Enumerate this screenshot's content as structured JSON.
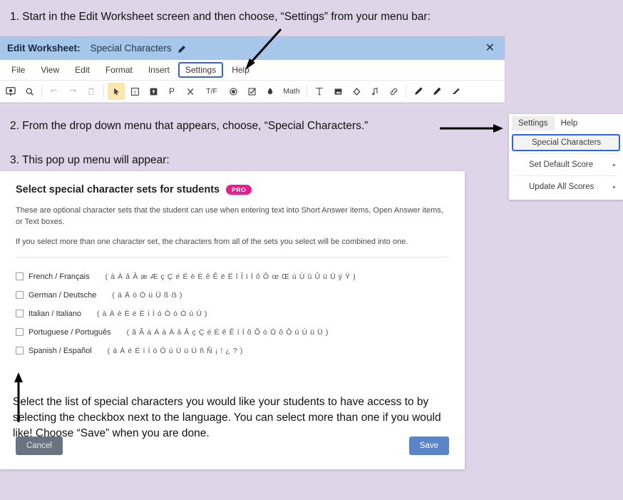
{
  "instructions": {
    "step1": "1. Start in the Edit Worksheet screen and then choose, “Settings” from your menu bar:",
    "step2": "2. From the drop down menu that appears, choose, “Special Characters.”",
    "step3": "3. This pop up menu will appear:",
    "bottom": "Select the list of special characters you would like your students to have access to by selecting the checkbox next to the language. You can select more than one if you would like! Choose “Save” when you are done."
  },
  "editor": {
    "title_label": "Edit Worksheet:",
    "document_name": "Special Characters",
    "edit_pencil_icon": "pencil-icon",
    "close_icon": "✕",
    "menu": [
      {
        "label": "File",
        "highlighted": false
      },
      {
        "label": "View",
        "highlighted": false
      },
      {
        "label": "Edit",
        "highlighted": false
      },
      {
        "label": "Format",
        "highlighted": false
      },
      {
        "label": "Insert",
        "highlighted": false
      },
      {
        "label": "Settings",
        "highlighted": true
      },
      {
        "label": "Help",
        "highlighted": false
      }
    ],
    "toolbar": [
      {
        "icon": "screen-present-icon",
        "glyph": "⬚",
        "state": "normal"
      },
      {
        "icon": "zoom-search-icon",
        "glyph": "⚲",
        "state": "normal"
      },
      {
        "sep": true
      },
      {
        "icon": "undo-icon",
        "glyph": "↶",
        "state": "disabled"
      },
      {
        "icon": "redo-icon",
        "glyph": "↷",
        "state": "disabled"
      },
      {
        "icon": "trash-icon",
        "glyph": "Ὕ1",
        "state": "disabled"
      },
      {
        "sep": true
      },
      {
        "icon": "cursor-select-icon",
        "glyph": "↖",
        "state": "active"
      },
      {
        "icon": "text-box-icon",
        "glyph": "Ⓣ",
        "state": "normal"
      },
      {
        "icon": "image-box-icon",
        "glyph": "▣",
        "state": "normal"
      },
      {
        "icon": "paragraph-icon",
        "glyph": "P",
        "state": "normal"
      },
      {
        "icon": "multiple-choice-icon",
        "glyph": "✗",
        "state": "normal"
      },
      {
        "icon": "true-false-icon",
        "glyph": "T/F",
        "state": "normal"
      },
      {
        "icon": "radio-button-icon",
        "glyph": "◉",
        "state": "normal"
      },
      {
        "icon": "checkbox-item-icon",
        "glyph": "☑",
        "state": "normal"
      },
      {
        "icon": "drop-item-icon",
        "glyph": "◆",
        "state": "normal"
      },
      {
        "icon": "math-icon",
        "glyph": "Math",
        "state": "normal"
      },
      {
        "sep": true
      },
      {
        "icon": "text-tool-icon",
        "glyph": "T",
        "state": "normal"
      },
      {
        "icon": "picture-icon",
        "glyph": "▤",
        "state": "normal"
      },
      {
        "icon": "shape-icon",
        "glyph": "◇",
        "state": "normal"
      },
      {
        "icon": "audio-icon",
        "glyph": "♪",
        "state": "normal"
      },
      {
        "icon": "link-icon",
        "glyph": "🔗",
        "state": "normal"
      },
      {
        "sep": true
      },
      {
        "icon": "pen-icon",
        "glyph": "✒",
        "state": "normal"
      },
      {
        "icon": "marker-icon",
        "glyph": "✒",
        "state": "normal"
      },
      {
        "icon": "eraser-icon",
        "glyph": "◢",
        "state": "normal"
      }
    ]
  },
  "dropdown": {
    "tabs": [
      {
        "label": "Settings",
        "active": true
      },
      {
        "label": "Help",
        "active": false
      }
    ],
    "items": [
      {
        "label": "Special Characters",
        "selected": true,
        "submenu": false
      },
      {
        "label": "Set Default Score",
        "selected": false,
        "submenu": true
      },
      {
        "label": "Update All Scores",
        "selected": false,
        "submenu": true
      }
    ],
    "submenu_caret": "▸"
  },
  "modal": {
    "title": "Select special character sets for students",
    "pro_badge": "PRO",
    "paragraph_1": "These are optional character sets that the student can use when entering text into Short Answer items, Open Answer items, or Text boxes.",
    "paragraph_2": "If you select more than one character set, the characters from all of the sets you select will be combined into one.",
    "languages": [
      {
        "name": "French / Français",
        "checked": false,
        "characters": "( à À  â Â  æ Æ  ç Ç  é É  è È  ê Ê  ë Ë  î Î  ï Ï  ô Ô  œ Œ  ù Ù  û Û  ü Ü  ÿ Ÿ )"
      },
      {
        "name": "German / Deutsche",
        "checked": false,
        "characters": "( ä Ä  ö Ö  ü Ü  ß ẞ )"
      },
      {
        "name": "Italian / Italiano",
        "checked": false,
        "characters": "( à À  è È  é É  ì Ì  ò Ò  ó Ó  ù Ù )"
      },
      {
        "name": "Portuguese / Português",
        "checked": false,
        "characters": "( ã Ã  á Á  à À  â Â  ç Ç  é É  ê Ê  í Í  õ Õ  ó Ó  ô Ô  ú Ú  ü Ü )"
      },
      {
        "name": "Spanish / Español",
        "checked": false,
        "characters": "( á Á  é É  í Í  ó Ó  ú Ú  ü Ü  ñ Ñ  ¡ !  ¿ ? )"
      }
    ],
    "cancel_label": "Cancel",
    "save_label": "Save"
  },
  "colors": {
    "page_background": "#ded5e8",
    "titlebar": "#a7c7ea",
    "highlight_border": "#2f63e8",
    "pro_badge": "#e91e8c",
    "save_button": "#5a85c9",
    "cancel_button": "#6b7280",
    "toolbar_active": "#fbe6ae"
  }
}
